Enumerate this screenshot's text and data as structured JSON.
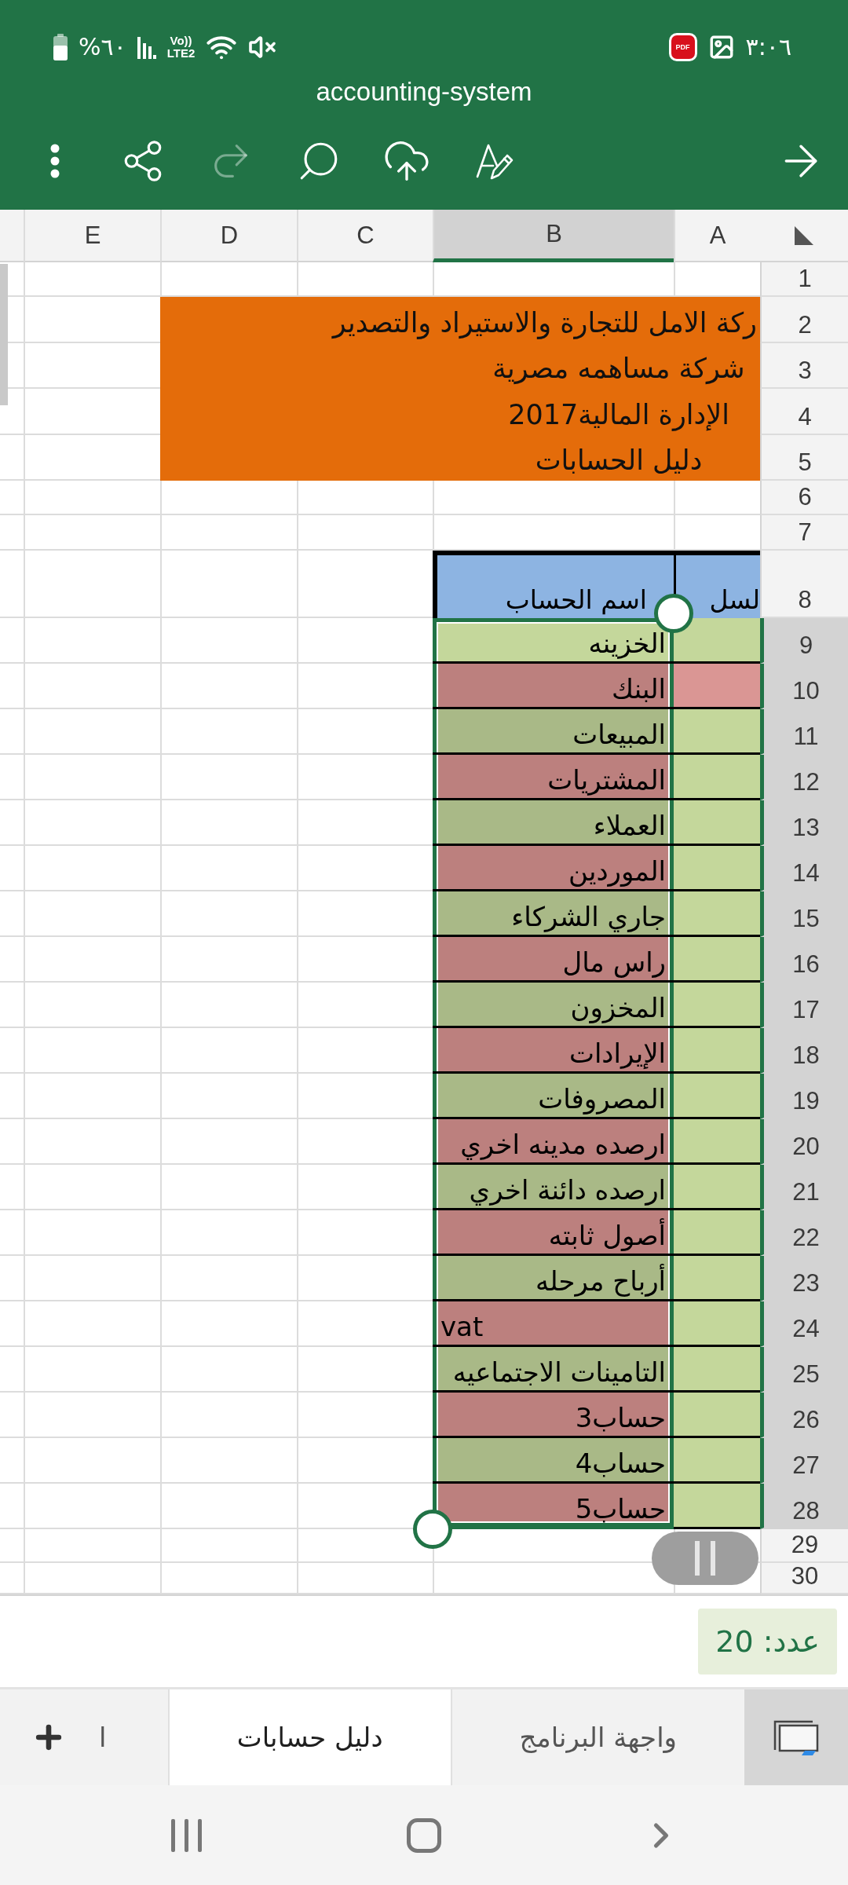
{
  "status_bar": {
    "battery": "%٦٠",
    "volte": "Vo))",
    "network": "LTE2",
    "app_badge": "PDF",
    "time": "٣:٠٦"
  },
  "window": {
    "title": "accounting-system"
  },
  "toolbar": [
    {
      "kind": "more",
      "disabled": false
    },
    {
      "kind": "share",
      "disabled": false
    },
    {
      "kind": "redo",
      "disabled": true
    },
    {
      "kind": "search",
      "disabled": false
    },
    {
      "kind": "upload",
      "disabled": false
    },
    {
      "kind": "draw",
      "disabled": false
    },
    {
      "kind": "forward",
      "disabled": false
    }
  ],
  "sheet": {
    "columns": [
      {
        "label": "A",
        "selected": false
      },
      {
        "label": "B",
        "selected": true
      },
      {
        "label": "C",
        "selected": false
      },
      {
        "label": "D",
        "selected": false
      },
      {
        "label": "E",
        "selected": false
      }
    ],
    "rows": [
      {
        "number": "1",
        "selected": false
      },
      {
        "number": "2",
        "selected": false
      },
      {
        "number": "3",
        "selected": false
      },
      {
        "number": "4",
        "selected": false
      },
      {
        "number": "5",
        "selected": false
      },
      {
        "number": "6",
        "selected": false
      },
      {
        "number": "7",
        "selected": false
      },
      {
        "number": "8",
        "selected": false
      },
      {
        "number": "9",
        "selected": true
      },
      {
        "number": "10",
        "selected": true
      },
      {
        "number": "11",
        "selected": true
      },
      {
        "number": "12",
        "selected": true
      },
      {
        "number": "13",
        "selected": true
      },
      {
        "number": "14",
        "selected": true
      },
      {
        "number": "15",
        "selected": true
      },
      {
        "number": "16",
        "selected": true
      },
      {
        "number": "17",
        "selected": true
      },
      {
        "number": "18",
        "selected": true
      },
      {
        "number": "19",
        "selected": true
      },
      {
        "number": "20",
        "selected": true
      },
      {
        "number": "21",
        "selected": true
      },
      {
        "number": "22",
        "selected": true
      },
      {
        "number": "23",
        "selected": true
      },
      {
        "number": "24",
        "selected": true
      },
      {
        "number": "25",
        "selected": true
      },
      {
        "number": "26",
        "selected": true
      },
      {
        "number": "27",
        "selected": true
      },
      {
        "number": "28",
        "selected": true
      },
      {
        "number": "29",
        "selected": false
      },
      {
        "number": "30",
        "selected": false
      }
    ],
    "banner": [
      "ركة الامل للتجارة والاستيراد والتصدير",
      "شركة مساهمه مصرية",
      "الإدارة المالية2017",
      "دليل الحسابات"
    ],
    "table": {
      "header": [
        "لسل",
        "اسم الحساب"
      ],
      "rows": [
        {
          "cell_a": {
            "color": "#c4d79b"
          },
          "cell_b": {
            "text": "الخزينه",
            "color": "#c4d79b"
          }
        },
        {
          "cell_a": {
            "color": "#da9694"
          },
          "cell_b": {
            "text": "البنك",
            "color": "#bc807e"
          }
        },
        {
          "cell_a": {
            "color": "#c4d79b"
          },
          "cell_b": {
            "text": "المبيعات",
            "color": "#a9b987"
          }
        },
        {
          "cell_a": {
            "color": "#c4d79b"
          },
          "cell_b": {
            "text": "المشتريات",
            "color": "#bc807e"
          }
        },
        {
          "cell_a": {
            "color": "#c4d79b"
          },
          "cell_b": {
            "text": "العملاء",
            "color": "#a9b987"
          }
        },
        {
          "cell_a": {
            "color": "#c4d79b"
          },
          "cell_b": {
            "text": "الموردين",
            "color": "#bc807e"
          }
        },
        {
          "cell_a": {
            "color": "#c4d79b"
          },
          "cell_b": {
            "text": "جاري الشركاء",
            "color": "#a9b987"
          }
        },
        {
          "cell_a": {
            "color": "#c4d79b"
          },
          "cell_b": {
            "text": "راس مال",
            "color": "#bc807e"
          }
        },
        {
          "cell_a": {
            "color": "#c4d79b"
          },
          "cell_b": {
            "text": "المخزون",
            "color": "#a9b987"
          }
        },
        {
          "cell_a": {
            "color": "#c4d79b"
          },
          "cell_b": {
            "text": "الإيرادات",
            "color": "#bc807e"
          }
        },
        {
          "cell_a": {
            "color": "#c4d79b"
          },
          "cell_b": {
            "text": "المصروفات",
            "color": "#a9b987"
          }
        },
        {
          "cell_a": {
            "color": "#c4d79b"
          },
          "cell_b": {
            "text": "ارصده مدينه اخري",
            "color": "#bc807e"
          }
        },
        {
          "cell_a": {
            "color": "#c4d79b"
          },
          "cell_b": {
            "text": "ارصده دائنة اخري",
            "color": "#a9b987"
          }
        },
        {
          "cell_a": {
            "color": "#c4d79b"
          },
          "cell_b": {
            "text": "أصول ثابته",
            "color": "#bc807e"
          }
        },
        {
          "cell_a": {
            "color": "#c4d79b"
          },
          "cell_b": {
            "text": "أرباح مرحله",
            "color": "#a9b987"
          }
        },
        {
          "cell_a": {
            "color": "#c4d79b"
          },
          "cell_b": {
            "text": "vat",
            "color": "#bc807e"
          }
        },
        {
          "cell_a": {
            "color": "#c4d79b"
          },
          "cell_b": {
            "text": "التامينات الاجتماعيه",
            "color": "#a9b987"
          }
        },
        {
          "cell_a": {
            "color": "#c4d79b"
          },
          "cell_b": {
            "text": "حساب3",
            "color": "#bc807e"
          }
        },
        {
          "cell_a": {
            "color": "#c4d79b"
          },
          "cell_b": {
            "text": "حساب4",
            "color": "#a9b987"
          }
        },
        {
          "cell_a": {
            "color": "#c4d79b"
          },
          "cell_b": {
            "text": "حساب5",
            "color": "#bc807e"
          }
        }
      ]
    }
  },
  "selection_count": "عدد: 20",
  "sheet_tabs": [
    {
      "label": "واجهة البرنامج",
      "selected": false
    },
    {
      "label": "دليل حسابات",
      "selected": true
    },
    {
      "label": "ا",
      "selected": false
    }
  ]
}
